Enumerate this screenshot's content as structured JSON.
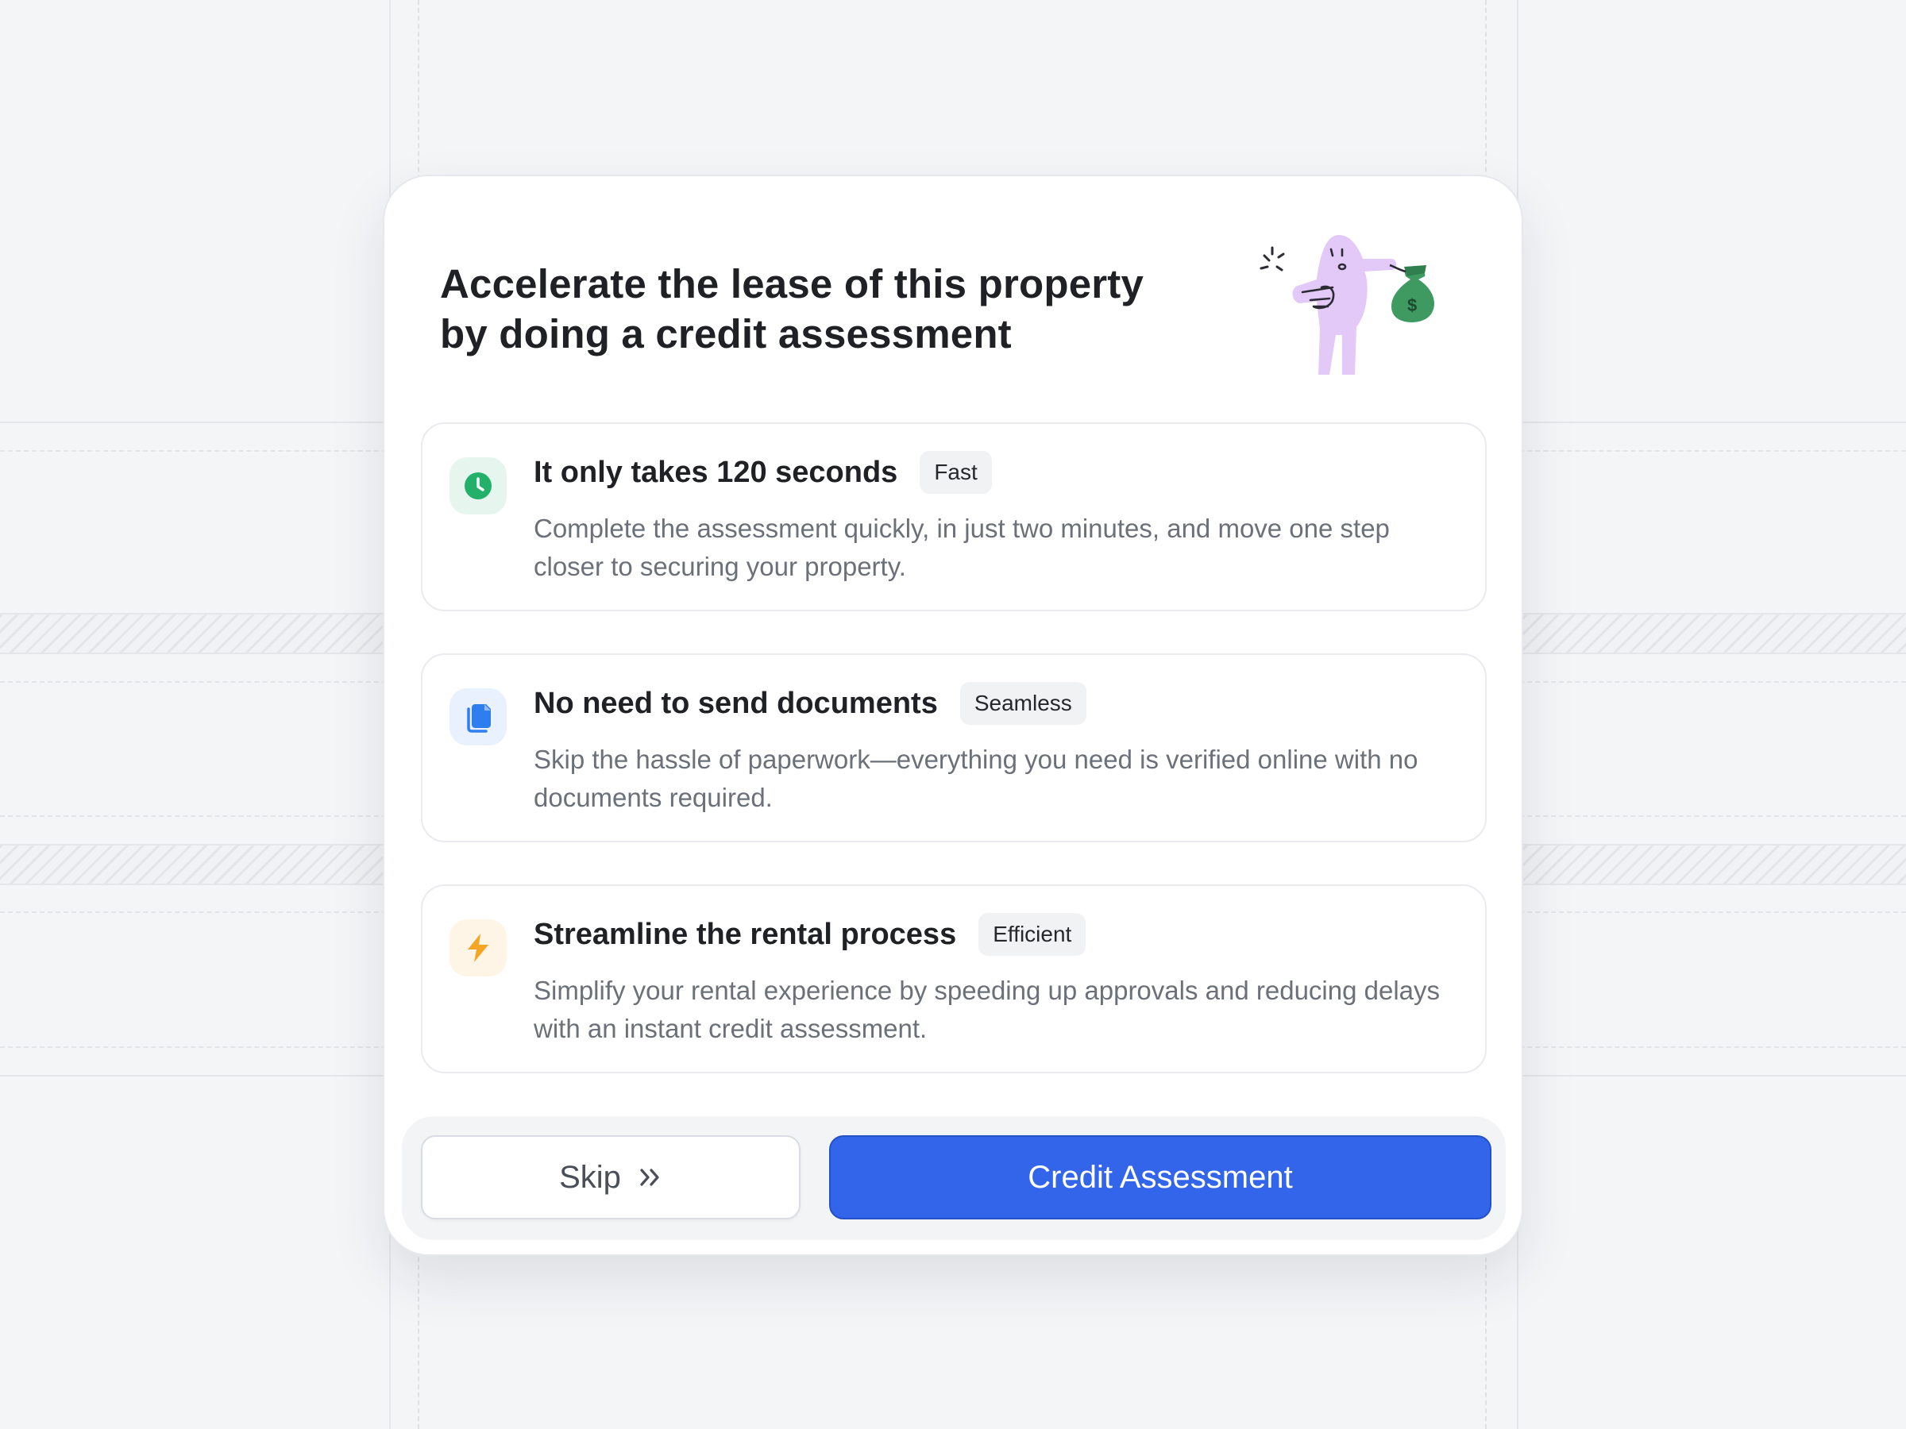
{
  "headline": "Accelerate the lease of this property by doing a credit assessment",
  "illustration": {
    "name": "character-holding-money-bag",
    "colors": {
      "body": "#e3c9f7",
      "bag": "#3f9a62"
    }
  },
  "features": [
    {
      "title": "It only takes 120 seconds",
      "badge": "Fast",
      "description": "Complete the assessment quickly, in just two minutes, and move one step closer to securing your property.",
      "icon": "clock-icon",
      "icon_color": "#23b06a",
      "icon_bg": "#e6f6ee"
    },
    {
      "title": "No need to send documents",
      "badge": "Seamless",
      "description": "Skip the hassle of paperwork—everything you need is verified online with no documents required.",
      "icon": "documents-icon",
      "icon_color": "#2f7ef0",
      "icon_bg": "#e8f1fd"
    },
    {
      "title": "Streamline the rental process",
      "badge": "Efficient",
      "description": "Simplify your rental experience by speeding up approvals and reducing delays with an instant credit assessment.",
      "icon": "lightning-icon",
      "icon_color": "#f5a524",
      "icon_bg": "#fef5e6"
    }
  ],
  "actions": {
    "skip_label": "Skip",
    "skip_icon": "double-chevron-right-icon",
    "primary_label": "Credit Assessment",
    "primary_color": "#3265ea"
  }
}
